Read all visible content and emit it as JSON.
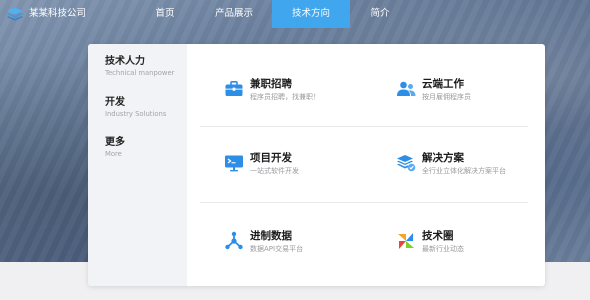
{
  "brand": {
    "name": "某某科技公司",
    "icon": "stack-logo-icon",
    "color": "#3fa3ea"
  },
  "nav": {
    "items": [
      {
        "label": "首页"
      },
      {
        "label": "产品展示"
      },
      {
        "label": "技术方向",
        "active": true
      },
      {
        "label": "简介"
      }
    ],
    "active_color": "#40a6ee"
  },
  "menu": {
    "categories": [
      {
        "title": "技术人力",
        "subtitle": "Technical manpower"
      },
      {
        "title": "开发",
        "subtitle": "Industry Solutions"
      },
      {
        "title": "更多",
        "subtitle": "More"
      }
    ],
    "items": [
      {
        "title": "兼职招聘",
        "subtitle": "程序员招聘，找兼职！",
        "icon": "briefcase-icon"
      },
      {
        "title": "云端工作",
        "subtitle": "按月雇佣程序员",
        "icon": "users-icon"
      },
      {
        "title": "项目开发",
        "subtitle": "一站式软件开发",
        "icon": "monitor-icon"
      },
      {
        "title": "解决方案",
        "subtitle": "全行业立体化解决方案平台",
        "icon": "layers-icon"
      },
      {
        "title": "进制数据",
        "subtitle": "数据API交易平台",
        "icon": "network-icon"
      },
      {
        "title": "技术圈",
        "subtitle": "最新行业动态",
        "icon": "pinwheel-icon"
      }
    ],
    "icon_color": "#2c8ee6"
  }
}
